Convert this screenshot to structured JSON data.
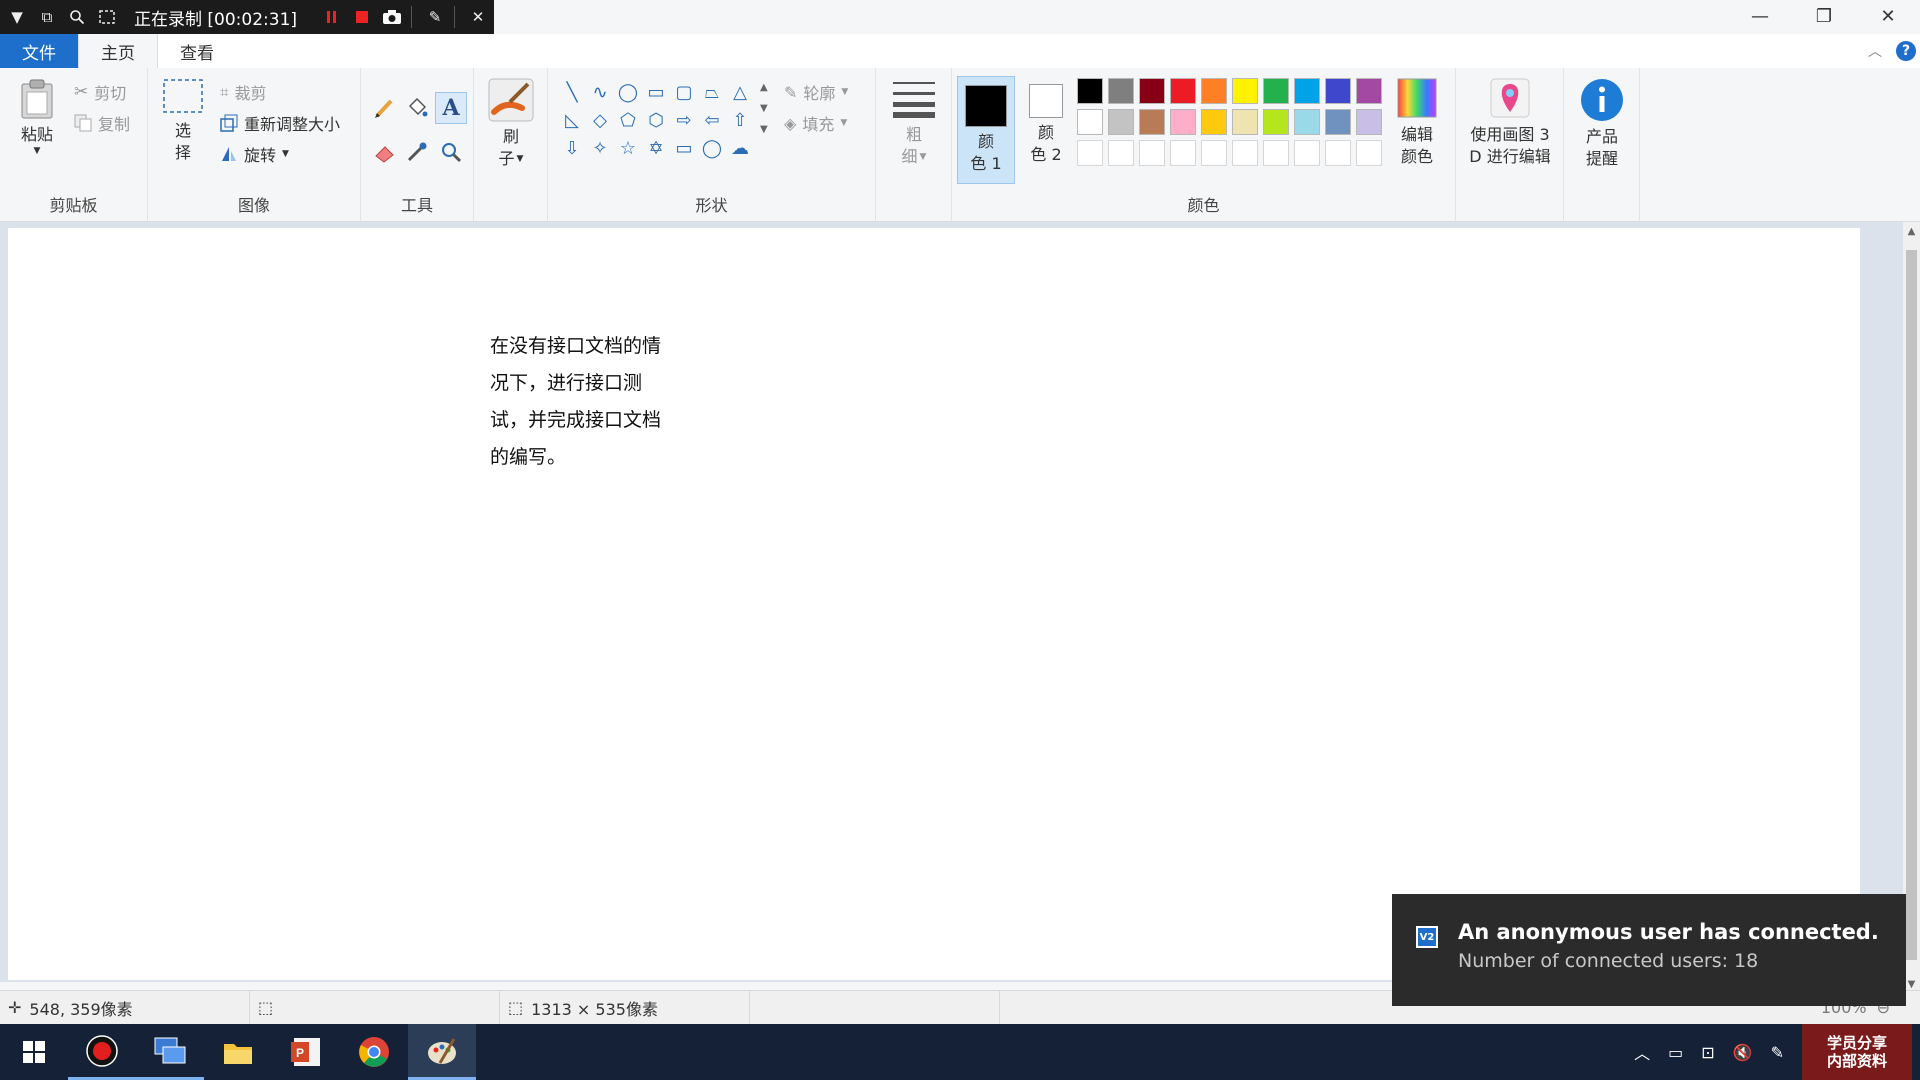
{
  "recorder": {
    "title": "正在录制 [00:02:31]",
    "icons": [
      "dropdown-icon",
      "window-icon",
      "zoom-icon",
      "region-icon",
      "pause-icon",
      "stop-icon",
      "camera-icon",
      "pen-icon",
      "close-icon"
    ]
  },
  "window": {
    "minimize": "—",
    "restore": "❐",
    "close": "✕"
  },
  "menu": {
    "file": "文件",
    "home": "主页",
    "view": "查看",
    "help": "?"
  },
  "ribbon": {
    "clipboard": {
      "label": "剪贴板",
      "paste": "粘贴",
      "cut": "剪切",
      "copy": "复制"
    },
    "image": {
      "label": "图像",
      "select_1": "选",
      "select_2": "择",
      "crop": "裁剪",
      "resize": "重新调整大小",
      "rotate": "旋转"
    },
    "tools": {
      "label": "工具"
    },
    "brushes": {
      "line1": "刷",
      "line2": "子"
    },
    "shapes": {
      "label": "形状",
      "outline": "轮廓",
      "fill": "填充"
    },
    "size": {
      "line1": "粗",
      "line2": "细"
    },
    "colors": {
      "label": "颜色",
      "color1_a": "颜",
      "color1_b": "色 1",
      "color2_a": "颜",
      "color2_b": "色 2",
      "edit_a": "编辑",
      "edit_b": "颜色",
      "color1_value": "#000000",
      "color2_value": "#ffffff",
      "palette": [
        "#000000",
        "#7f7f7f",
        "#880015",
        "#ed1c24",
        "#ff7f27",
        "#fff200",
        "#22b14c",
        "#00a2e8",
        "#3f48cc",
        "#a349a4",
        "#ffffff",
        "#c3c3c3",
        "#b97a57",
        "#ffaec9",
        "#ffc90e",
        "#efe4b0",
        "#b5e61d",
        "#99d9ea",
        "#7092be",
        "#c8bfe7"
      ]
    },
    "paint3d": {
      "line1": "使用画图 3",
      "line2": "D 进行编辑"
    },
    "product": {
      "line1": "产品",
      "line2": "提醒"
    }
  },
  "canvas": {
    "text_lines": [
      "在没有接口文档的情",
      "况下，进行接口测",
      "试，并完成接口文档",
      "的编写。"
    ]
  },
  "status": {
    "cursor": "548, 359像素",
    "size": "1313 × 535像素",
    "zoom": "100%"
  },
  "toast": {
    "title": "An anonymous user has connected.",
    "body": "Number of connected users: 18",
    "icon": "V2"
  },
  "taskbar": {
    "apps": [
      "start-icon",
      "recorder-app-icon",
      "remote-desktop-icon",
      "file-explorer-icon",
      "powerpoint-icon",
      "chrome-icon",
      "paint-icon"
    ],
    "stamp_line1": "学员分享",
    "stamp_line2": "内部资料"
  }
}
